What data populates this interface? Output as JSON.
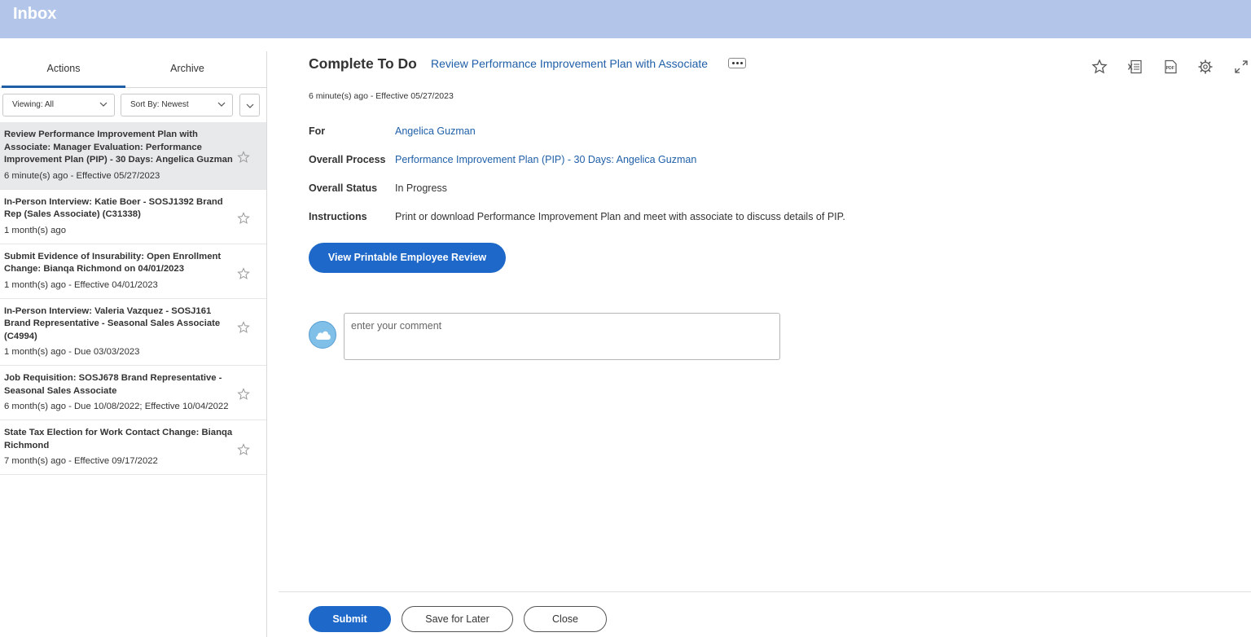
{
  "header": {
    "title": "Inbox"
  },
  "sidebar": {
    "tabs": [
      {
        "label": "Actions",
        "active": true
      },
      {
        "label": "Archive",
        "active": false
      }
    ],
    "filters": {
      "viewing": "Viewing: All",
      "sort": "Sort By: Newest"
    },
    "tasks": [
      {
        "title": "Review Performance Improvement Plan with Associate: Manager Evaluation: Performance Improvement Plan (PIP) - 30 Days: Angelica Guzman",
        "meta": "6 minute(s) ago - Effective 05/27/2023",
        "selected": true
      },
      {
        "title": "In-Person Interview: Katie Boer - SOSJ1392 Brand Rep (Sales Associate) (C31338)",
        "meta": "1 month(s) ago",
        "selected": false
      },
      {
        "title": "Submit Evidence of Insurability: Open Enrollment Change: Bianqa Richmond on 04/01/2023",
        "meta": "1 month(s) ago - Effective 04/01/2023",
        "selected": false
      },
      {
        "title": "In-Person Interview: Valeria Vazquez - SOSJ161 Brand Representative - Seasonal Sales Associate (C4994)",
        "meta": "1 month(s) ago - Due 03/03/2023",
        "selected": false
      },
      {
        "title": "Job Requisition: SOSJ678 Brand Representative - Seasonal Sales Associate",
        "meta": "6 month(s) ago - Due 10/08/2022; Effective 10/04/2022",
        "selected": false
      },
      {
        "title": "State Tax Election for Work Contact Change: Bianqa Richmond",
        "meta": "7 month(s) ago - Effective 09/17/2022",
        "selected": false
      }
    ]
  },
  "main": {
    "heading": "Complete To Do",
    "task_link": "Review Performance Improvement Plan with Associate",
    "timestamp": "6 minute(s) ago -  Effective 05/27/2023",
    "fields": {
      "for_label": "For",
      "for_value": "Angelica Guzman",
      "process_label": "Overall Process",
      "process_value": "Performance Improvement Plan (PIP) - 30 Days: Angelica Guzman",
      "status_label": "Overall Status",
      "status_value": "In Progress",
      "instructions_label": "Instructions",
      "instructions_value": "Print or download Performance Improvement Plan and meet with associate to discuss details of PIP."
    },
    "view_button": "View Printable Employee Review",
    "comment_placeholder": "enter your comment",
    "toolbar_icons": [
      "star-icon",
      "excel-icon",
      "pdf-icon",
      "gear-icon",
      "expand-icon"
    ]
  },
  "footer": {
    "submit": "Submit",
    "save": "Save for Later",
    "close": "Close"
  },
  "colors": {
    "header": "#b3c6ea",
    "link": "#1f5fa8",
    "primary": "#1d68c9",
    "selected_row": "#e8e9eb"
  }
}
